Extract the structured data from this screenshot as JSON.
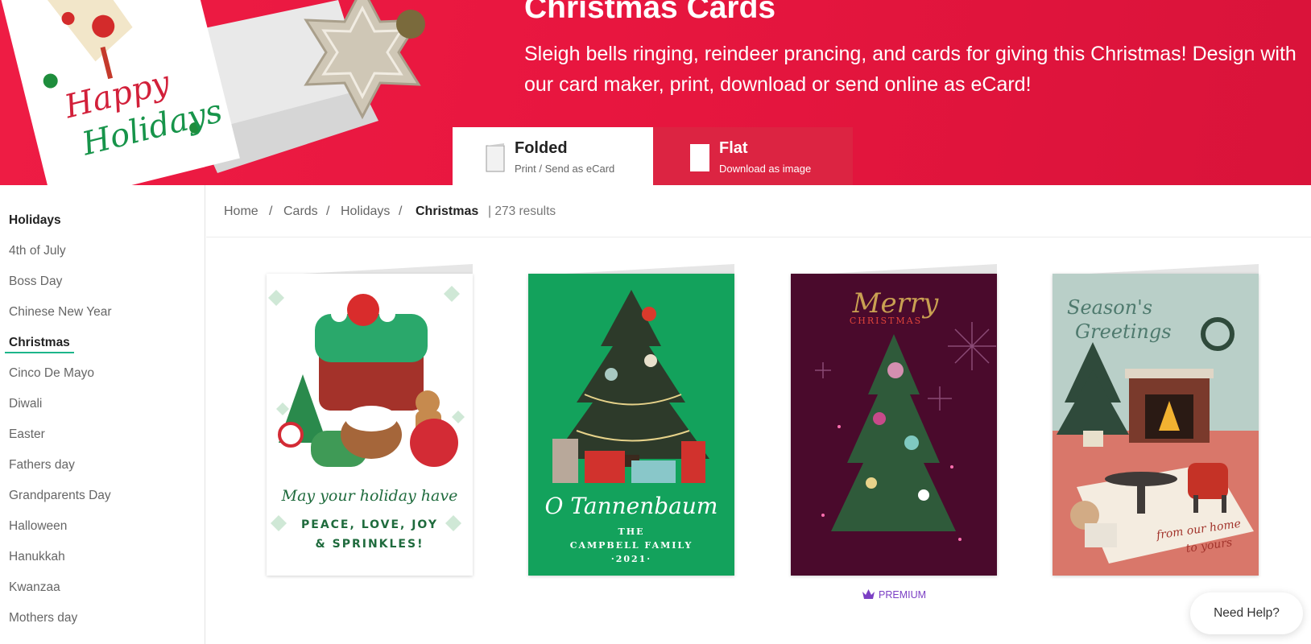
{
  "hero": {
    "title": "Christmas Cards",
    "description": "Sleigh bells ringing, reindeer prancing, and cards for giving this Christmas! Design with our card maker, print, download or send online as eCard!",
    "promo_card_text_line1": "Happy",
    "promo_card_text_line2": "Holidays",
    "background_color": "#e8163f"
  },
  "tabs": [
    {
      "title": "Folded",
      "subtitle": "Print / Send as eCard",
      "selected": true
    },
    {
      "title": "Flat",
      "subtitle": "Download as image",
      "selected": false
    }
  ],
  "sidebar": {
    "heading": "Holidays",
    "items": [
      {
        "label": "4th of July"
      },
      {
        "label": "Boss Day"
      },
      {
        "label": "Chinese New Year"
      },
      {
        "label": "Christmas",
        "active": true
      },
      {
        "label": "Cinco De Mayo"
      },
      {
        "label": "Diwali"
      },
      {
        "label": "Easter"
      },
      {
        "label": "Fathers day"
      },
      {
        "label": "Grandparents Day"
      },
      {
        "label": "Halloween"
      },
      {
        "label": "Hanukkah"
      },
      {
        "label": "Kwanzaa"
      },
      {
        "label": "Mothers day"
      }
    ],
    "accent_color": "#1db58a"
  },
  "breadcrumb": {
    "items": [
      "Home",
      "Cards",
      "Holidays",
      "Christmas"
    ],
    "separator": "/",
    "results": "| 273 results"
  },
  "cards": [
    {
      "name": "Sprinkles card",
      "text1": "May your holiday have",
      "text2": "PEACE, LOVE, JOY",
      "text3": "& SPRINKLES!",
      "bg": "#ffffff"
    },
    {
      "name": "O Tannenbaum card",
      "text1": "O Tannenbaum",
      "text2": "THE",
      "text3": "CAMPBELL FAMILY",
      "text4": "·2021·",
      "bg": "#13a25c"
    },
    {
      "name": "Merry Christmas card",
      "text1": "Merry",
      "text2": "CHRISTMAS",
      "bg": "#4a0a2c",
      "premium": true
    },
    {
      "name": "Season's Greetings card",
      "text1": "Season's",
      "text2": "Greetings",
      "text3": "from our home",
      "text4": "to yours",
      "bg": "#b9cfc8"
    }
  ],
  "premium_label": "PREMIUM",
  "help_button": "Need Help?"
}
